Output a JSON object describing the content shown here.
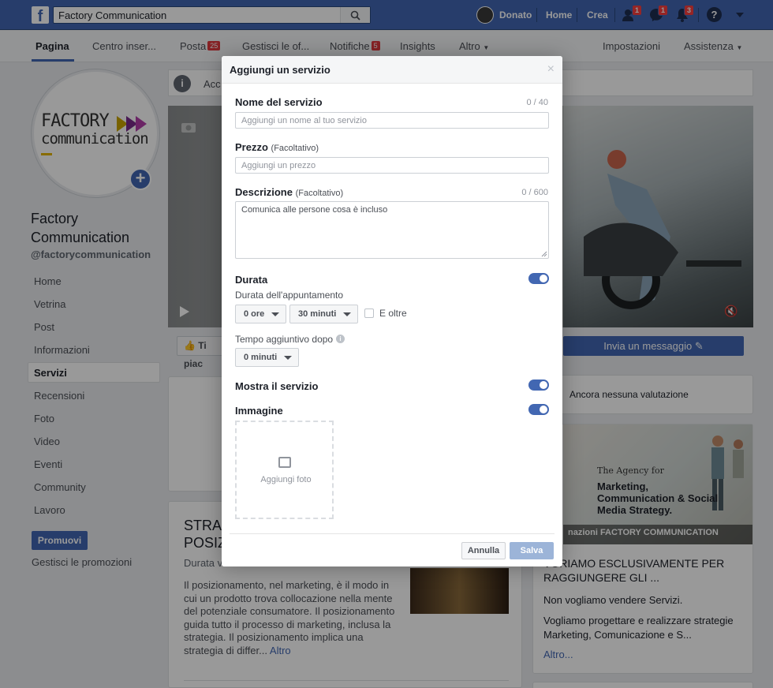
{
  "topbar": {
    "search_value": "Factory Communication",
    "user_name": "Donato",
    "home": "Home",
    "create": "Crea",
    "friend_requests": "1",
    "messages": "1",
    "notifications": "3",
    "help": "?"
  },
  "page_nav": {
    "page": "Pagina",
    "inbox": "Centro inser...",
    "posts": "Posta",
    "posts_count": "25",
    "manage_offers": "Gestisci le of...",
    "notifications": "Notifiche",
    "notifications_count": "5",
    "insights": "Insights",
    "more": "Altro",
    "settings": "Impostazioni",
    "help": "Assistenza"
  },
  "profile": {
    "logo_line1": "FACTORY",
    "logo_line2": "communication",
    "name": "Factory Communication",
    "handle": "@factorycommunication"
  },
  "sidebar": {
    "items": [
      "Home",
      "Vetrina",
      "Post",
      "Informazioni",
      "Servizi",
      "Recensioni",
      "Foto",
      "Video",
      "Eventi",
      "Community",
      "Lavoro"
    ],
    "promote": "Promuovi",
    "manage_promotions": "Gestisci le promozioni"
  },
  "cover": {
    "about_text": "Acc",
    "like_btn": "Ti piac",
    "message_btn": "Invia un messaggio"
  },
  "right_column": {
    "rating_text": "Ancora nessuna valutazione",
    "ad_the": "The Agency for",
    "ad_headline": "Marketing, Communication & Social Media Strategy.",
    "ad_strip": "nazioni FACTORY COMMUNICATION",
    "ad_title": "VORIAMO ESCLUSIVAMENTE PER RAGGIUNGERE GLI ...",
    "ad_p1": "Non vogliamo vendere Servizi.",
    "ad_p2": "Vogliamo progettare e realizzare strategie Marketing, Comunicazione e S...",
    "ad_more": "Altro..."
  },
  "service_card": {
    "title": "STRA POSIZ",
    "duration": "Durata v",
    "desc": "Il posizionamento, nel marketing, è il modo in cui un prodotto trova collocazione nella mente del potenziale consumatore. Il posizionamento guida tutto il processo di marketing, inclusa la strategia. Il posizionamento implica una strategia di differ...",
    "more": "Altro"
  },
  "modal": {
    "title": "Aggiungi un servizio",
    "close": "×",
    "name_label": "Nome del servizio",
    "name_counter": "0 / 40",
    "name_placeholder": "Aggiungi un nome al tuo servizio",
    "price_label": "Prezzo",
    "optional": "(Facoltativo)",
    "price_placeholder": "Aggiungi un prezzo",
    "desc_label": "Descrizione",
    "desc_counter": "0 / 600",
    "desc_placeholder": "Comunica alle persone cosa è incluso",
    "duration_label": "Durata",
    "duration_enabled": true,
    "appointment_label": "Durata dell'appuntamento",
    "hours_value": "0 ore",
    "minutes_value": "30 minuti",
    "and_more": "E oltre",
    "extra_time_label": "Tempo aggiuntivo dopo",
    "extra_minutes_value": "0 minuti",
    "show_service_label": "Mostra il servizio",
    "image_label": "Immagine",
    "add_photo": "Aggiungi foto",
    "cancel": "Annulla",
    "save": "Salva"
  },
  "colors": {
    "brand_blue": "#4267b2",
    "badge_red": "#fa3e3e",
    "save_disabled": "#9cb4d8"
  }
}
